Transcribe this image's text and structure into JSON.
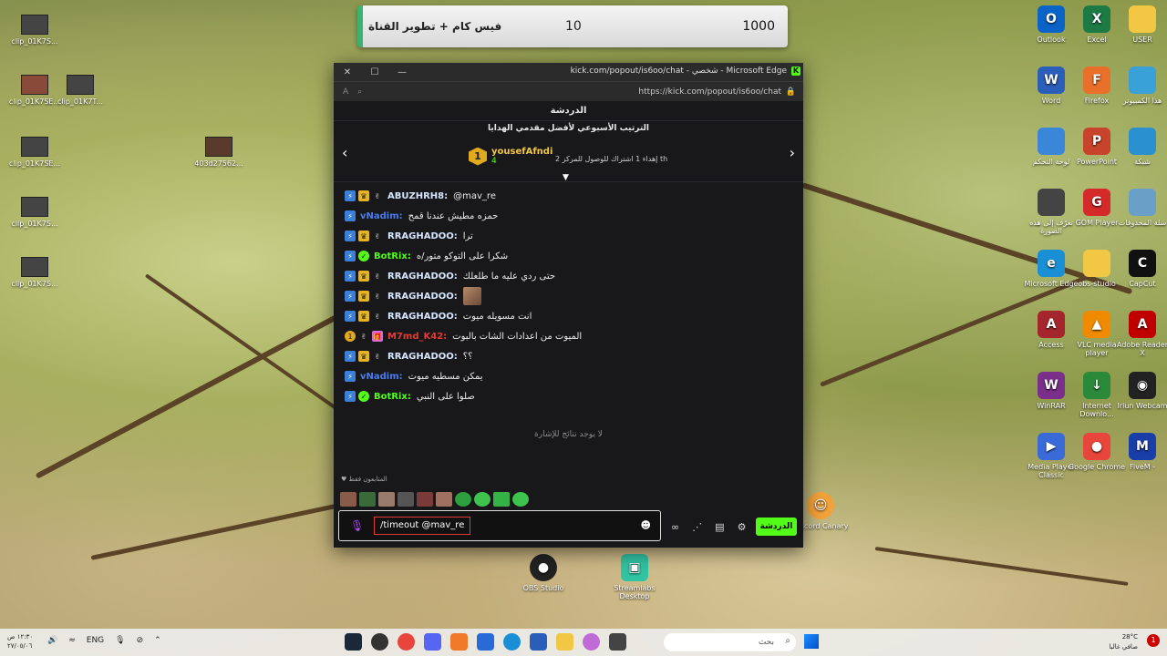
{
  "overlay": {
    "title": "فيس كام + تطوير القناة",
    "count": "10",
    "goal": "1000"
  },
  "desktop_left": [
    {
      "label": "clip_01K7S..."
    },
    {
      "label": "clip_01K7SE..."
    },
    {
      "label": "clip_01K7T..."
    },
    {
      "label": "clip_01K7SE..."
    },
    {
      "label": "403d27562..."
    },
    {
      "label": "clip_01K7S..."
    },
    {
      "label": "clip_01K7S..."
    }
  ],
  "desktop_right": [
    {
      "label": "Outlook",
      "glyph": "O",
      "color": "#0a64c8"
    },
    {
      "label": "Excel",
      "glyph": "X",
      "color": "#1d7a45"
    },
    {
      "label": "USER",
      "glyph": "",
      "color": "#f2c744"
    },
    {
      "label": "Word",
      "glyph": "W",
      "color": "#2b5eb8"
    },
    {
      "label": "Firefox",
      "glyph": "F",
      "color": "#e8702a"
    },
    {
      "label": "هذا الكمبيوتر",
      "glyph": "",
      "color": "#3aa0d8"
    },
    {
      "label": "لوحة التحكم",
      "glyph": "",
      "color": "#3a86d8"
    },
    {
      "label": "PowerPoint",
      "glyph": "P",
      "color": "#c8432b"
    },
    {
      "label": "شبكة",
      "glyph": "",
      "color": "#2a90d0"
    },
    {
      "label": "تعرّف إلى هذه الصورة",
      "glyph": "",
      "color": "#444444"
    },
    {
      "label": "GOM Player",
      "glyph": "G",
      "color": "#d42a2a"
    },
    {
      "label": "سلة المحذوفات",
      "glyph": "",
      "color": "#6aa0c8"
    },
    {
      "label": "Microsoft Edge",
      "glyph": "e",
      "color": "#1b8fd6"
    },
    {
      "label": "obs-studio",
      "glyph": "",
      "color": "#f2c744"
    },
    {
      "label": "CapCut",
      "glyph": "C",
      "color": "#111111"
    },
    {
      "label": "Access",
      "glyph": "A",
      "color": "#a4262c"
    },
    {
      "label": "VLC media player",
      "glyph": "▲",
      "color": "#f08a00"
    },
    {
      "label": "Adobe Reader X",
      "glyph": "A",
      "color": "#c00000"
    },
    {
      "label": "WinRAR",
      "glyph": "W",
      "color": "#7a2f8a"
    },
    {
      "label": "Internet Downlo...",
      "glyph": "↓",
      "color": "#2a8a3a"
    },
    {
      "label": "Iriun Webcam",
      "glyph": "◉",
      "color": "#222222"
    },
    {
      "label": "Media Player Classic",
      "glyph": "▶",
      "color": "#3a6ad8"
    },
    {
      "label": "Google Chrome",
      "glyph": "●",
      "color": "#e8453c"
    },
    {
      "label": "FiveM -",
      "glyph": "M",
      "color": "#1a3ea8"
    }
  ],
  "desktop_mid": [
    {
      "label": "OBS Studio"
    },
    {
      "label": "Streamlabs Desktop"
    },
    {
      "label": "Discord Canary"
    }
  ],
  "browser": {
    "title": "kick.com/popout/is6oo/chat - شخصي - Microsoft Edge",
    "url": "https://kick.com/popout/is6oo/chat"
  },
  "chat": {
    "header": "الدردشة",
    "pinned_title": "الترتيب الأسبوعي لأفضل مقدمي الهدايا",
    "rank": "1",
    "top_user": "yousefAfndi",
    "top_count": "4",
    "pinned_desc": "إهداء 1 اشتراك للوصول للمركز 2",
    "pinned_suffix": "th",
    "messages": [
      {
        "badges": [
          "mod",
          "vip",
          "sub"
        ],
        "user": "ABUZHRH8:",
        "color": "#d6e6ff",
        "text": "@mav_re"
      },
      {
        "badges": [
          "mod"
        ],
        "user": "vNadim:",
        "color": "#4a7cf0",
        "text": "حمزه مطيش عندنا قمح"
      },
      {
        "badges": [
          "mod",
          "vip",
          "sub"
        ],
        "user": "RRAGHADOO:",
        "color": "#d6e6ff",
        "text": "ترا"
      },
      {
        "badges": [
          "mod",
          "bot"
        ],
        "user": "BotRix:",
        "color": "#53fc18",
        "text": "شكرا على التوكو متور/ه"
      },
      {
        "badges": [
          "mod",
          "vip",
          "sub"
        ],
        "user": "RRAGHADOO:",
        "color": "#d6e6ff",
        "text": "حتى ردي عليه ما طلعلك"
      },
      {
        "badges": [
          "mod",
          "vip",
          "sub"
        ],
        "user": "RRAGHADOO:",
        "color": "#d6e6ff",
        "text": "",
        "emote": true
      },
      {
        "badges": [
          "mod",
          "vip",
          "sub"
        ],
        "user": "RRAGHADOO:",
        "color": "#d6e6ff",
        "text": "انت مسويله ميوت"
      },
      {
        "badges": [
          "num",
          "sub",
          "gift"
        ],
        "user": "M7md_K42:",
        "color": "#e53935",
        "text": "الميوت من اعدادات الشات بالبوت"
      },
      {
        "badges": [
          "mod",
          "vip",
          "sub"
        ],
        "user": "RRAGHADOO:",
        "color": "#d6e6ff",
        "text": "؟؟"
      },
      {
        "badges": [
          "mod"
        ],
        "user": "vNadim:",
        "color": "#4a7cf0",
        "text": "يمكن مسطيه ميوت"
      },
      {
        "badges": [
          "mod",
          "bot"
        ],
        "user": "BotRix:",
        "color": "#53fc18",
        "text": "صلوا على النبي"
      }
    ],
    "empty_note": "لا يوجد نتائج للإشارة",
    "followers_only": "المتابعون فقط",
    "input_value": "/timeout @mav_re",
    "send_label": "الدردشة"
  },
  "taskbar": {
    "time": "١٢:٣٠ ص",
    "date": "٢٧/٠٥/٠٦",
    "lang": "ENG",
    "search_placeholder": "بحث",
    "temp": "28°C",
    "weather": "صافي غالبا",
    "notifications": "1"
  }
}
